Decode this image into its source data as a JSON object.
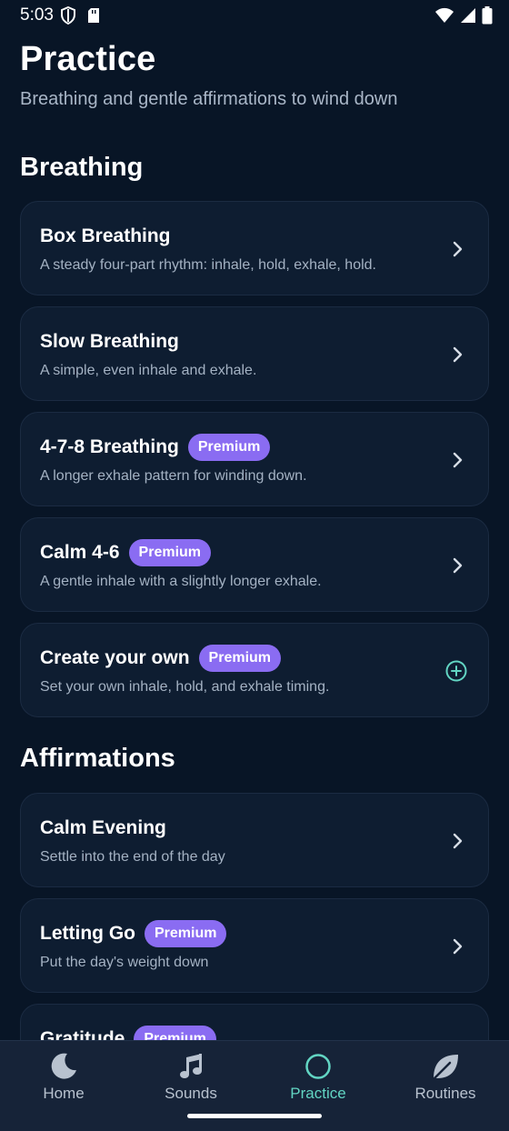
{
  "status_bar": {
    "time": "5:03"
  },
  "header": {
    "title": "Practice",
    "subtitle": "Breathing and gentle affirmations to wind down"
  },
  "sections": {
    "breathing": {
      "title": "Breathing",
      "items": [
        {
          "title": "Box Breathing",
          "description": "A steady four-part rhythm: inhale, hold, exhale, hold.",
          "badge": "",
          "action_icon": "chevron-right-icon"
        },
        {
          "title": "Slow Breathing",
          "description": "A simple, even inhale and exhale.",
          "badge": "",
          "action_icon": "chevron-right-icon"
        },
        {
          "title": "4-7-8 Breathing",
          "description": "A longer exhale pattern for winding down.",
          "badge": "Premium",
          "action_icon": "chevron-right-icon"
        },
        {
          "title": "Calm 4-6",
          "description": "A gentle inhale with a slightly longer exhale.",
          "badge": "Premium",
          "action_icon": "chevron-right-icon"
        },
        {
          "title": "Create your own",
          "description": "Set your own inhale, hold, and exhale timing.",
          "badge": "Premium",
          "action_icon": "plus-circle-icon"
        }
      ]
    },
    "affirmations": {
      "title": "Affirmations",
      "items": [
        {
          "title": "Calm Evening",
          "description": "Settle into the end of the day",
          "badge": "",
          "action_icon": "chevron-right-icon"
        },
        {
          "title": "Letting Go",
          "description": "Put the day's weight down",
          "badge": "Premium",
          "action_icon": "chevron-right-icon"
        },
        {
          "title": "Gratitude",
          "description": "",
          "badge": "Premium",
          "action_icon": "chevron-right-icon"
        }
      ]
    }
  },
  "bottom_nav": {
    "items": [
      {
        "label": "Home",
        "icon": "moon-icon",
        "active": false
      },
      {
        "label": "Sounds",
        "icon": "music-note-icon",
        "active": false
      },
      {
        "label": "Practice",
        "icon": "circle-icon",
        "active": true
      },
      {
        "label": "Routines",
        "icon": "leaf-icon",
        "active": false
      }
    ]
  },
  "colors": {
    "background": "#081526",
    "card": "#0e1d31",
    "badge": "#8a6cf2",
    "accent": "#62d5c3",
    "nav_background": "#162338"
  }
}
